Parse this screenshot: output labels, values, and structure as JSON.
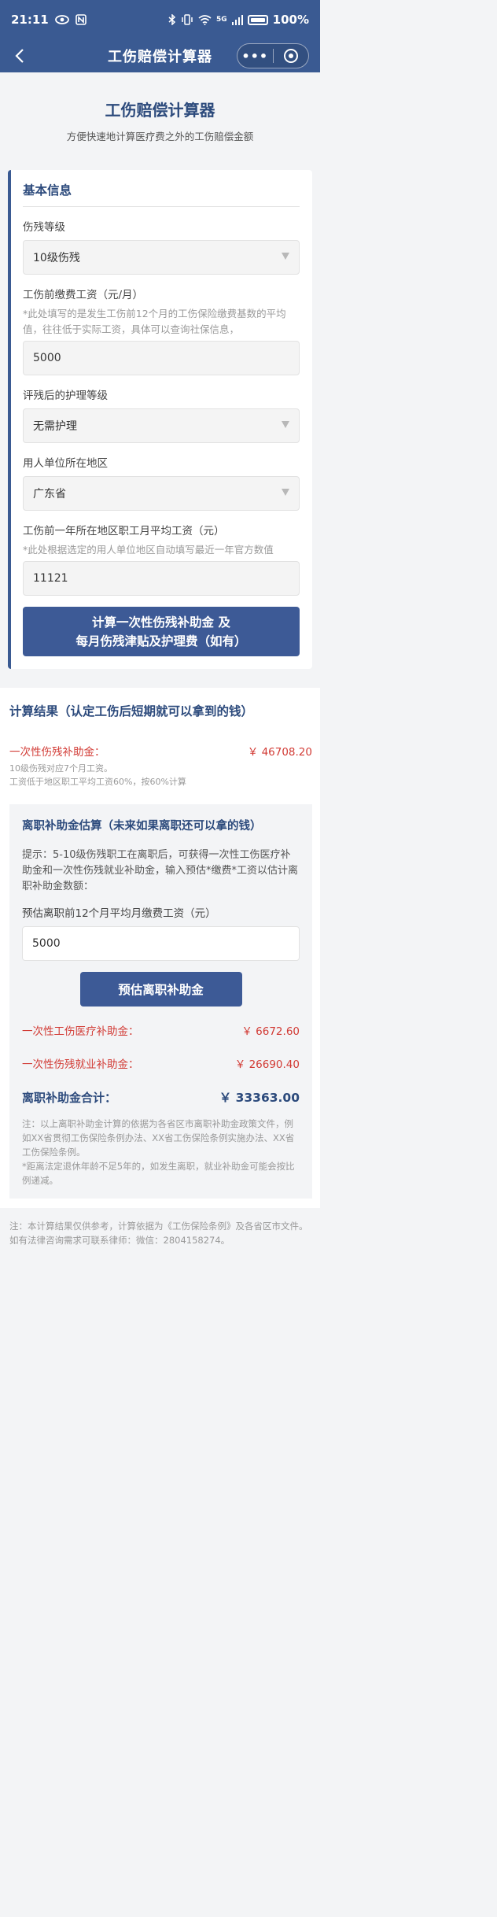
{
  "status": {
    "time": "21:11",
    "battery": "100%",
    "network": "5G"
  },
  "nav": {
    "title": "工伤赔偿计算器"
  },
  "header": {
    "title": "工伤赔偿计算器",
    "subtitle": "方便快速地计算医疗费之外的工伤赔偿金额"
  },
  "basic": {
    "section_title": "基本信息",
    "disability_label": "伤残等级",
    "disability_value": "10级伤残",
    "wage_label": "工伤前缴费工资（元/月）",
    "wage_hint": "*此处填写的是发生工伤前12个月的工伤保险缴费基数的平均值，往往低于实际工资，具体可以查询社保信息，",
    "wage_value": "5000",
    "care_label": "评残后的护理等级",
    "care_value": "无需护理",
    "region_label": "用人单位所在地区",
    "region_value": "广东省",
    "avg_label": "工伤前一年所在地区职工月平均工资（元）",
    "avg_hint": "*此处根据选定的用人单位地区自动填写最近一年官方数值",
    "avg_value": "11121",
    "calc_btn_line1": "计算一次性伤残补助金 及",
    "calc_btn_line2": "每月伤残津贴及护理费（如有）"
  },
  "result": {
    "title": "计算结果（认定工伤后短期就可以拿到的钱）",
    "lump_label": "一次性伤残补助金：",
    "lump_value": "￥ 46708.20",
    "note1": "10级伤残对应7个月工资。",
    "note2": "工资低于地区职工平均工资60%，按60%计算"
  },
  "resign": {
    "title": "离职补助金估算（未来如果离职还可以拿的钱）",
    "tip": "提示：5-10级伤残职工在离职后，可获得一次性工伤医疗补助金和一次性伤残就业补助金，输入预估*缴费*工资以估计离职补助金数额：",
    "input_label": "预估离职前12个月平均月缴费工资（元）",
    "input_value": "5000",
    "btn": "预估离职补助金",
    "medical_label": "一次性工伤医疗补助金：",
    "medical_value": "￥ 6672.60",
    "employment_label": "一次性伤残就业补助金：",
    "employment_value": "￥ 26690.40",
    "total_label": "离职补助金合计：",
    "total_value": "￥ 33363.00",
    "note1": "注：以上离职补助金计算的依据为各省区市离职补助金政策文件，例如XX省贯彻工伤保险条例办法、XX省工伤保险条例实施办法、XX省工伤保险条例。",
    "note2": "*距离法定退休年龄不足5年的，如发生离职，就业补助金可能会按比例递减。"
  },
  "footer": {
    "text": "注：本计算结果仅供参考，计算依据为《工伤保险条例》及各省区市文件。如有法律咨询需求可联系律师：微信：2804158274。"
  }
}
